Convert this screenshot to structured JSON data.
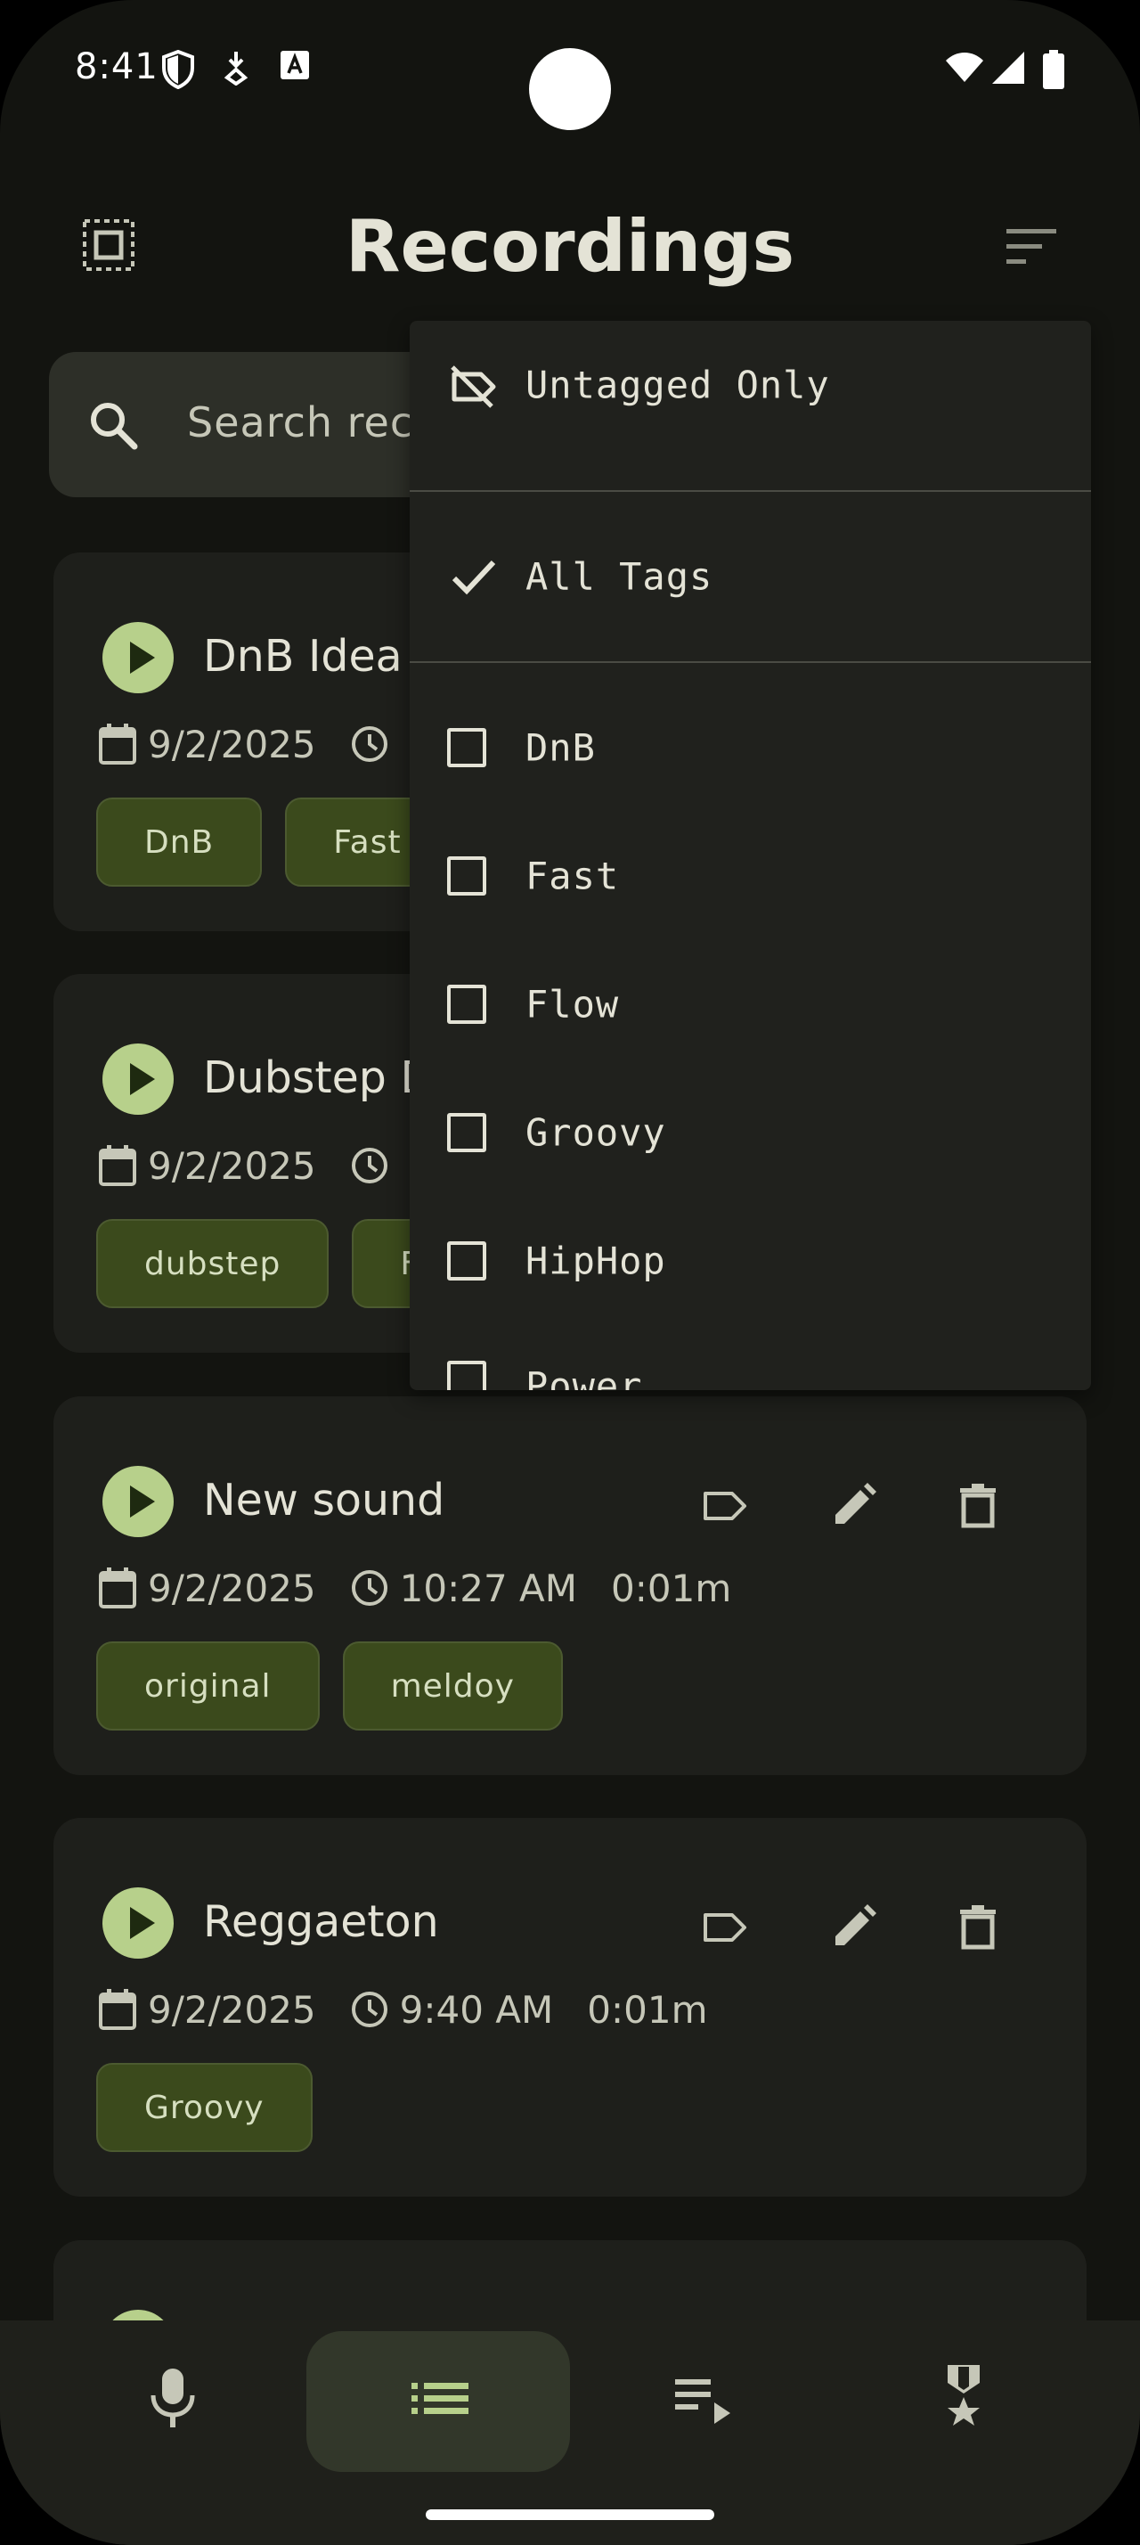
{
  "status_bar": {
    "time": "8:41"
  },
  "header": {
    "title": "Recordings"
  },
  "search": {
    "placeholder": "Search recordings"
  },
  "recordings": [
    {
      "title": "DnB Idea",
      "date": "9/2/2025",
      "time": "",
      "duration": "",
      "tags": [
        "DnB",
        "Fast"
      ]
    },
    {
      "title": "Dubstep D",
      "date": "9/2/2025",
      "time": "",
      "duration": "",
      "tags": [
        "dubstep",
        "F"
      ]
    },
    {
      "title": "New sound",
      "date": "9/2/2025",
      "time": "10:27 AM",
      "duration": "0:01m",
      "tags": [
        "original",
        "meldoy"
      ]
    },
    {
      "title": "Reggaeton",
      "date": "9/2/2025",
      "time": "9:40 AM",
      "duration": "0:01m",
      "tags": [
        "Groovy"
      ]
    }
  ],
  "tag_filter_menu": {
    "untagged_only": "Untagged Only",
    "all_tags": "All Tags",
    "all_tags_selected": true,
    "tags": [
      "DnB",
      "Fast",
      "Flow",
      "Groovy",
      "HipHop",
      "Power"
    ]
  },
  "bottom_nav": {
    "items": [
      "record",
      "recordings",
      "playlists",
      "achievements"
    ],
    "active": "recordings"
  },
  "colors": {
    "background": "#131410",
    "card": "#1e1f1b",
    "accent": "#b7d08b",
    "tag_bg": "#3b4a1c",
    "menu_bg": "#20211d"
  }
}
